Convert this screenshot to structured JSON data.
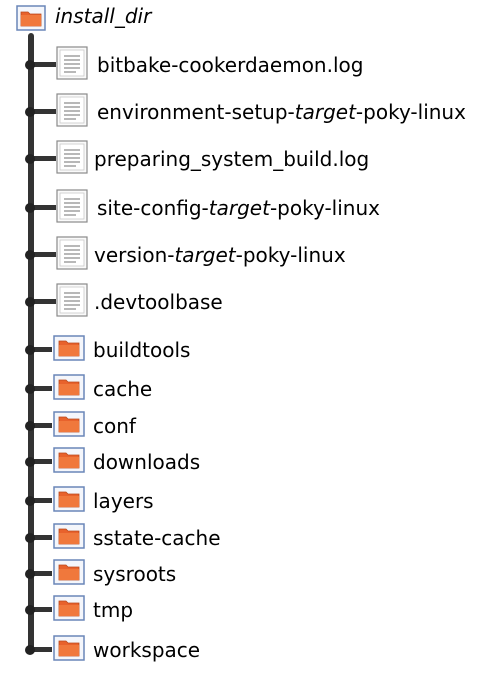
{
  "root": {
    "label": "install_dir",
    "icon": "folder-icon"
  },
  "items": [
    {
      "type": "file",
      "parts": [
        {
          "t": "bitbake-cookerdaemon.log",
          "i": false
        }
      ],
      "icon": "document-icon"
    },
    {
      "type": "file",
      "parts": [
        {
          "t": "environment-setup-",
          "i": false
        },
        {
          "t": "target",
          "i": true
        },
        {
          "t": "-poky-linux",
          "i": false
        }
      ],
      "icon": "document-icon"
    },
    {
      "type": "file",
      "parts": [
        {
          "t": "preparing_system_build.log",
          "i": false
        }
      ],
      "icon": "document-icon"
    },
    {
      "type": "file",
      "parts": [
        {
          "t": "site-config-",
          "i": false
        },
        {
          "t": "target",
          "i": true
        },
        {
          "t": "-poky-linux",
          "i": false
        }
      ],
      "icon": "document-icon"
    },
    {
      "type": "file",
      "parts": [
        {
          "t": "version-",
          "i": false
        },
        {
          "t": "target",
          "i": true
        },
        {
          "t": "-poky-linux",
          "i": false
        }
      ],
      "icon": "document-icon"
    },
    {
      "type": "file",
      "parts": [
        {
          "t": ".devtoolbase",
          "i": false
        }
      ],
      "icon": "document-icon"
    },
    {
      "type": "folder",
      "parts": [
        {
          "t": "buildtools",
          "i": false
        }
      ],
      "icon": "folder-icon"
    },
    {
      "type": "folder",
      "parts": [
        {
          "t": "cache",
          "i": false
        }
      ],
      "icon": "folder-icon"
    },
    {
      "type": "folder",
      "parts": [
        {
          "t": "conf",
          "i": false
        }
      ],
      "icon": "folder-icon"
    },
    {
      "type": "folder",
      "parts": [
        {
          "t": "downloads",
          "i": false
        }
      ],
      "icon": "folder-icon"
    },
    {
      "type": "folder",
      "parts": [
        {
          "t": "layers",
          "i": false
        }
      ],
      "icon": "folder-icon"
    },
    {
      "type": "folder",
      "parts": [
        {
          "t": "sstate-cache",
          "i": false
        }
      ],
      "icon": "folder-icon"
    },
    {
      "type": "folder",
      "parts": [
        {
          "t": "sysroots",
          "i": false
        }
      ],
      "icon": "folder-icon"
    },
    {
      "type": "folder",
      "parts": [
        {
          "t": "tmp",
          "i": false
        }
      ],
      "icon": "folder-icon"
    },
    {
      "type": "folder",
      "parts": [
        {
          "t": "workspace",
          "i": false
        }
      ],
      "icon": "folder-icon"
    }
  ],
  "colors": {
    "line": "#333333",
    "folder_fill": "#e8622c",
    "folder_border": "#6a86b8",
    "doc_border": "#8a8a8a"
  }
}
